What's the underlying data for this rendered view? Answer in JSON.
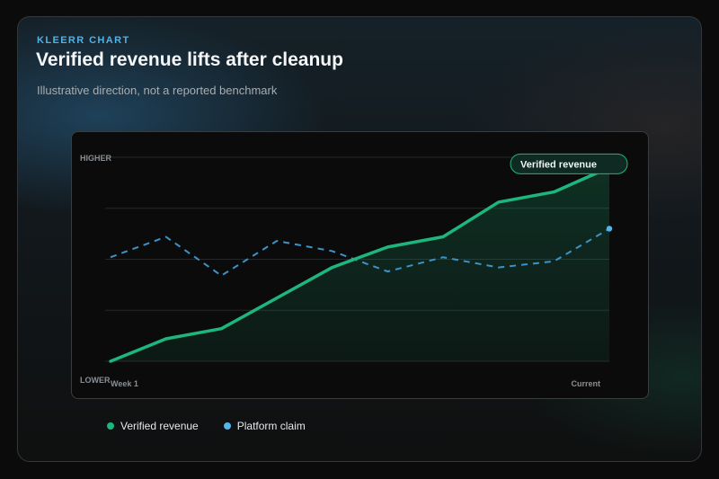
{
  "eyebrow": "KLEERR CHART",
  "title": "Verified revenue lifts after cleanup",
  "subtitle": "Illustrative direction, not a reported benchmark",
  "colors": {
    "verified": "#1db67e",
    "claim": "#3d93c8",
    "claim_dot": "#52b6ea"
  },
  "chart_data": {
    "type": "line",
    "categories": [
      "Week 1",
      "",
      "",
      "",
      "",
      "",
      "",
      "",
      "",
      "Current"
    ],
    "y_axis_labels": {
      "top": "HIGHER",
      "bottom": "LOWER"
    },
    "ylim": [
      0,
      100
    ],
    "grid": true,
    "series": [
      {
        "name": "Verified revenue",
        "style": "solid-area",
        "values": [
          0,
          11,
          16,
          31,
          46,
          56,
          61,
          78,
          83,
          95
        ]
      },
      {
        "name": "Platform claim",
        "style": "dashed",
        "values": [
          51,
          61,
          42,
          59,
          54,
          44,
          51,
          46,
          49,
          65
        ]
      }
    ],
    "annotation": {
      "text": "Verified revenue",
      "series": "Verified revenue",
      "at": "Current"
    }
  },
  "legend": {
    "items": [
      {
        "label": "Verified revenue",
        "color": "#1db67e"
      },
      {
        "label": "Platform claim",
        "color": "#52b6ea"
      }
    ]
  }
}
